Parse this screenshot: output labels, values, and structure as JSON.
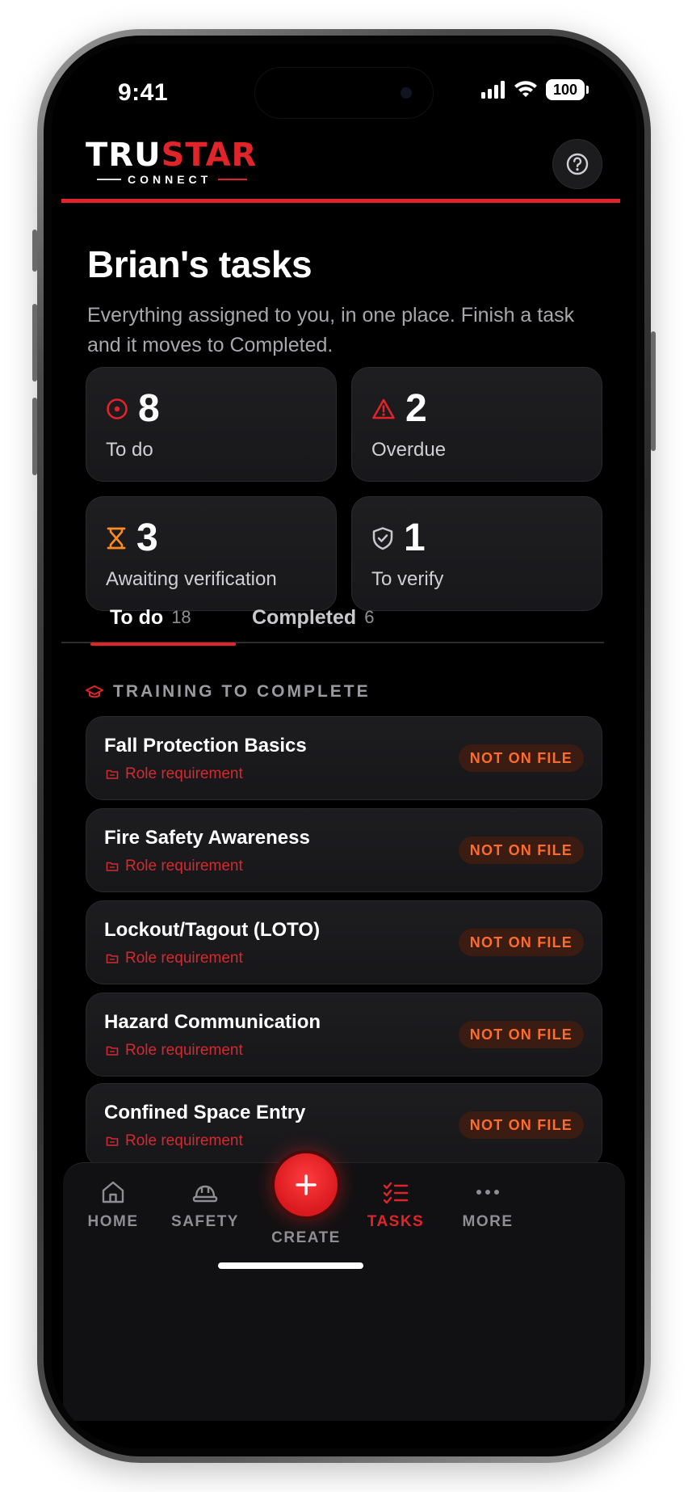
{
  "status_bar": {
    "time": "9:41",
    "battery": "100"
  },
  "brand": {
    "logo_part1": "TRU",
    "logo_part2": "STAR",
    "logo_sub": "CONNECT"
  },
  "header": {
    "title": "Brian's tasks",
    "subtitle": "Everything assigned to you, in one place. Finish a task and it moves to Completed."
  },
  "stats": [
    {
      "value": "8",
      "label": "To do",
      "icon": "target-icon",
      "color": "#e0242a"
    },
    {
      "value": "2",
      "label": "Overdue",
      "icon": "warning-triangle-icon",
      "color": "#e0242a"
    },
    {
      "value": "3",
      "label": "Awaiting verification",
      "icon": "hourglass-icon",
      "color": "#ff8a1f"
    },
    {
      "value": "1",
      "label": "To verify",
      "icon": "shield-check-icon",
      "color": "#c7c7cc"
    }
  ],
  "tabs": [
    {
      "label": "To do",
      "count": "18",
      "active": true
    },
    {
      "label": "Completed",
      "count": "6",
      "active": false
    }
  ],
  "section": {
    "title": "TRAINING TO COMPLETE",
    "icon": "graduation-cap-icon"
  },
  "tasks": [
    {
      "title": "Fall Protection Basics",
      "tag": "Role requirement",
      "badge": "NOT ON FILE"
    },
    {
      "title": "Fire Safety Awareness",
      "tag": "Role requirement",
      "badge": "NOT ON FILE"
    },
    {
      "title": "Lockout/Tagout (LOTO)",
      "tag": "Role requirement",
      "badge": "NOT ON FILE"
    },
    {
      "title": "Hazard Communication",
      "tag": "Role requirement",
      "badge": "NOT ON FILE"
    },
    {
      "title": "Confined Space Entry",
      "tag": "Role requirement",
      "badge": "NOT ON FILE"
    }
  ],
  "nav": {
    "home": "HOME",
    "safety": "SAFETY",
    "create": "CREATE",
    "tasks": "TASKS",
    "more": "MORE",
    "active": "tasks"
  },
  "colors": {
    "accent": "#e0242a",
    "badge_text": "#ff6b2c",
    "badge_bg": "#3a1c12",
    "background": "#000000"
  }
}
